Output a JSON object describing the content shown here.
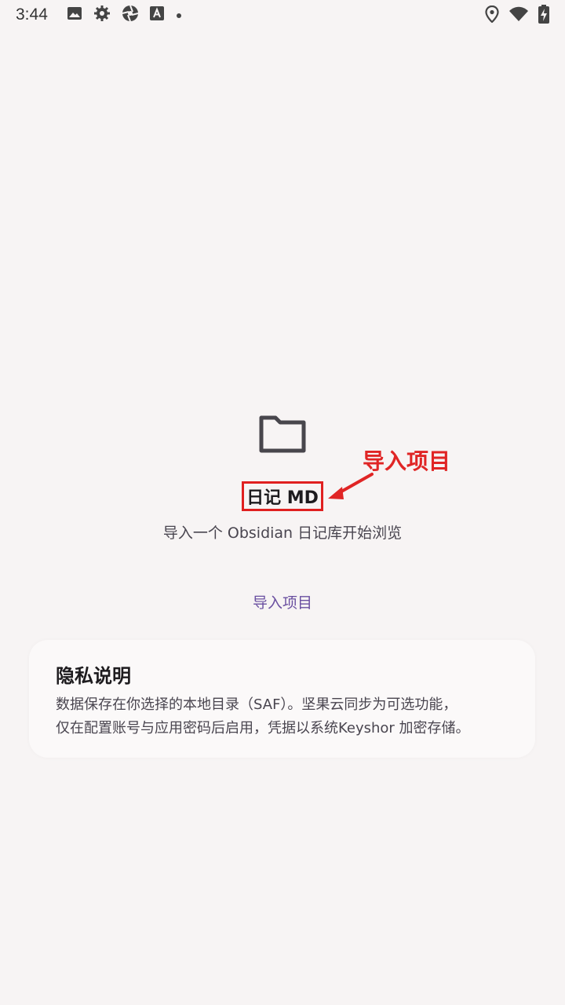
{
  "status_bar": {
    "time": "3:44",
    "left_icons": [
      "image-icon",
      "gear-icon",
      "aperture-icon",
      "font-a-icon",
      "dot-icon"
    ],
    "right_icons": [
      "location-icon",
      "wifi-icon",
      "battery-charging-icon"
    ]
  },
  "empty_state": {
    "icon": "folder-icon",
    "title": "日记 MD",
    "subtitle": "导入一个 Obsidian 日记库开始浏览",
    "import_label": "导入项目"
  },
  "annotation": {
    "label": "导入项目",
    "color": "#e02525"
  },
  "privacy": {
    "title": "隐私说明",
    "line1": "数据保存在你选择的本地目录（SAF）。坚果云同步为可选功能，",
    "line2": "仅在配置账号与应用密码后启用，凭据以系统Keyshor 加密存储。"
  },
  "colors": {
    "background": "#f7f4f4",
    "accent": "#6a4fa0",
    "highlight_border": "#e02020"
  }
}
